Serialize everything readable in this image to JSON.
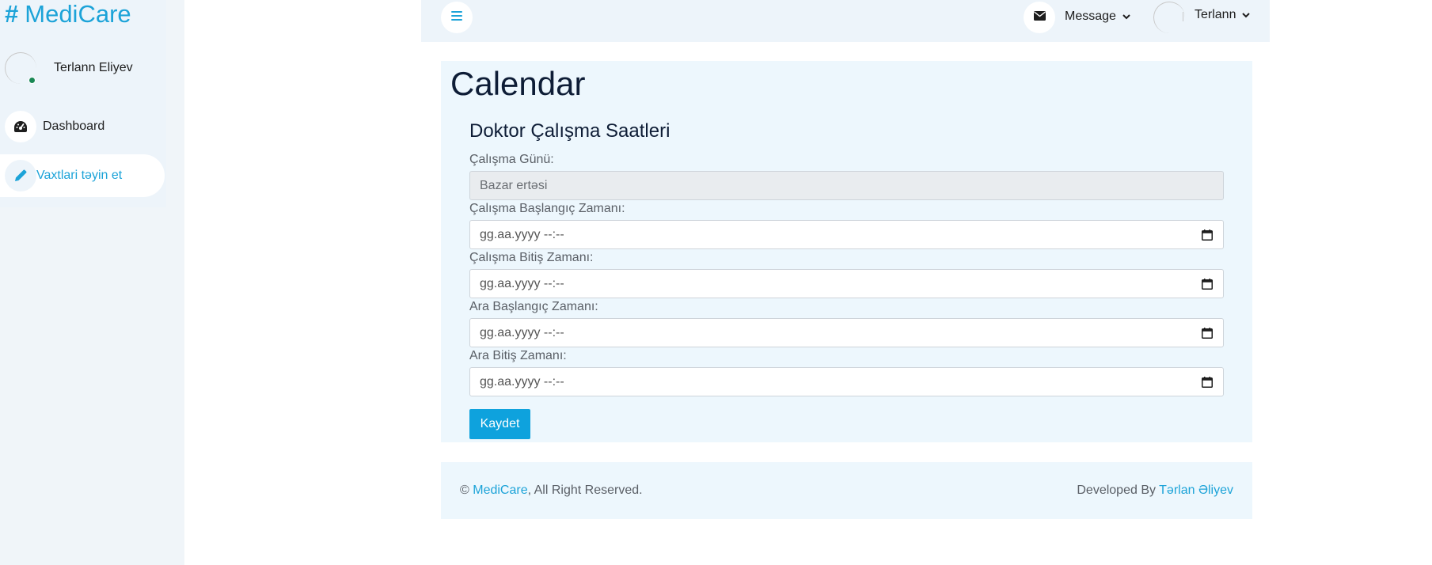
{
  "app": {
    "brand_symbol": "#",
    "brand_name": "MediCare",
    "accent_color": "#1ca3d8",
    "button_color": "#0ea2dd"
  },
  "sidebar": {
    "user_name": "Terlann Eliyev",
    "status": "online",
    "items": [
      {
        "label": "Dashboard",
        "icon": "gauge-icon",
        "active": false
      },
      {
        "label": "Vaxtlari təyin et",
        "icon": "pencil-icon",
        "active": true
      }
    ]
  },
  "topbar": {
    "menu_icon": "hamburger-icon",
    "message_label": "Message",
    "message_icon": "envelope-icon",
    "user_label": "Terlann"
  },
  "main": {
    "page_title": "Calendar",
    "form_title": "Doktor Çalışma Saatleri",
    "fields": [
      {
        "label": "Çalışma Günü:",
        "value": "Bazar ertəsi",
        "readonly": true
      },
      {
        "label": "Çalışma Başlangıç Zamanı:",
        "placeholder": "gg.aa.yyyy --:--",
        "type": "datetime-local"
      },
      {
        "label": "Çalışma Bitiş Zamanı:",
        "placeholder": "gg.aa.yyyy --:--",
        "type": "datetime-local"
      },
      {
        "label": "Ara Başlangıç Zamanı:",
        "placeholder": "gg.aa.yyyy --:--",
        "type": "datetime-local"
      },
      {
        "label": "Ara Bitiş Zamanı:",
        "placeholder": "gg.aa.yyyy --:--",
        "type": "datetime-local"
      }
    ],
    "submit_label": "Kaydet"
  },
  "footer": {
    "copyright_symbol": "©",
    "brand_link": "MediCare",
    "rights_text": ", All Right Reserved.",
    "developed_by": "Developed By",
    "developer_link": "Tərlan Əliyev"
  }
}
